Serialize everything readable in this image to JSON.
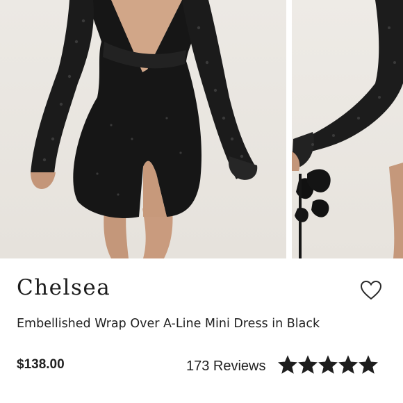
{
  "product": {
    "brand": "Chelsea",
    "title": "Embellished Wrap Over A-Line Mini Dress in Black",
    "price": "$138.00",
    "reviews_label": "173 Reviews",
    "rating": 5,
    "rating_max": 5
  },
  "icons": {
    "wishlist": "heart-outline-icon",
    "star": "star-filled-icon"
  },
  "colors": {
    "dress": "#141414",
    "skin": "#c79a7c",
    "background": "#e9e6e1",
    "text": "#1a1a1a"
  }
}
